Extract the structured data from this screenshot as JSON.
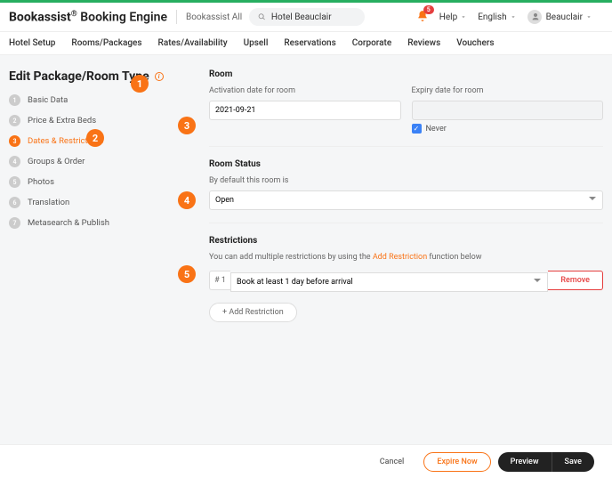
{
  "header": {
    "brand_a": "Bookassist",
    "brand_b": "Booking Engine",
    "account": "Bookassist All",
    "search_value": "Hotel Beauclair",
    "badge": "5",
    "help": "Help",
    "lang": "English",
    "user": "Beauclair"
  },
  "nav": [
    "Hotel Setup",
    "Rooms/Packages",
    "Rates/Availability",
    "Upsell",
    "Reservations",
    "Corporate",
    "Reviews",
    "Vouchers"
  ],
  "page_title": "Edit Package/Room Type",
  "steps": [
    {
      "n": "1",
      "label": "Basic Data"
    },
    {
      "n": "2",
      "label": "Price & Extra Beds"
    },
    {
      "n": "3",
      "label": "Dates & Restrictions"
    },
    {
      "n": "4",
      "label": "Groups & Order"
    },
    {
      "n": "5",
      "label": "Photos"
    },
    {
      "n": "6",
      "label": "Translation"
    },
    {
      "n": "7",
      "label": "Metasearch & Publish"
    }
  ],
  "room": {
    "heading": "Room",
    "activation_label": "Activation date for room",
    "activation_value": "2021-09-21",
    "expiry_label": "Expiry date for room",
    "never": "Never"
  },
  "status": {
    "heading": "Room Status",
    "by_default": "By default this room is",
    "value": "Open"
  },
  "restrictions": {
    "heading": "Restrictions",
    "hint_a": "You can add multiple restrictions by using the ",
    "hint_b": "Add Restriction",
    "hint_c": " function below",
    "row_num": "# 1",
    "row_val": "Book at least 1 day before arrival",
    "remove": "Remove",
    "add": "+ Add Restriction"
  },
  "footer": {
    "cancel": "Cancel",
    "expire": "Expire Now",
    "preview": "Preview",
    "save": "Save"
  },
  "markers": {
    "m1": "1",
    "m2": "2",
    "m3": "3",
    "m4": "4",
    "m5": "5"
  }
}
